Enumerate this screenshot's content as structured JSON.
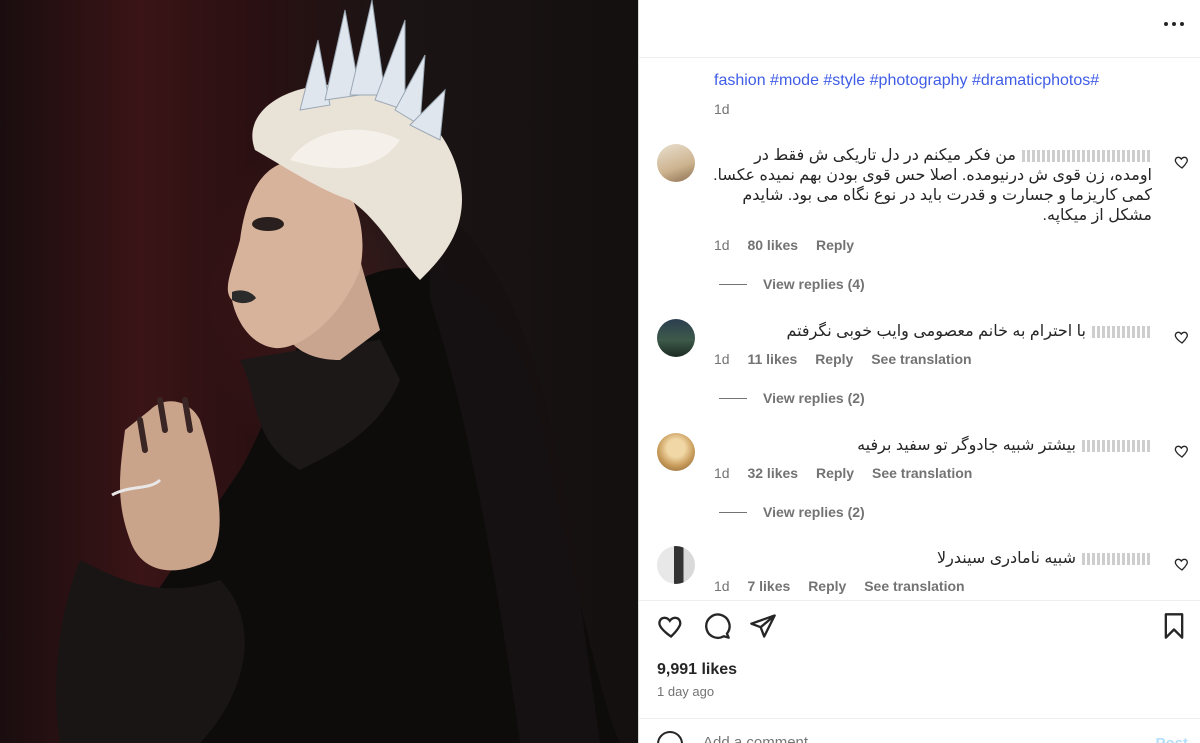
{
  "post": {
    "caption": "fashion #mode #style #photography #dramaticphotos#",
    "caption_time": "1d",
    "likes": "9,991 likes",
    "posted": "1 day ago"
  },
  "comments": [
    {
      "text": "من فکر میکنم در دل تاریکی ش فقط در اومده، زن قوی ش درنیومده. اصلا حس قوی بودن بهم نمیده عکسا. کمی کاریزما و جسارت و قدرت باید در نوع نگاه می بود. شایدم مشکل از میکاپه.",
      "time": "1d",
      "likes": "80 likes",
      "reply": "Reply",
      "translate": "",
      "replies": "View replies (4)"
    },
    {
      "text": "با احترام به خانم معصومی وایب خوبی نگرفتم",
      "time": "1d",
      "likes": "11 likes",
      "reply": "Reply",
      "translate": "See translation",
      "replies": "View replies (2)"
    },
    {
      "text": "بیشتر شبیه جادوگر تو سفید برفیه",
      "time": "1d",
      "likes": "32 likes",
      "reply": "Reply",
      "translate": "See translation",
      "replies": "View replies (2)"
    },
    {
      "text": "شبیه نامادری سیندرلا",
      "time": "1d",
      "likes": "7 likes",
      "reply": "Reply",
      "translate": "See translation",
      "replies": ""
    }
  ],
  "add_comment": {
    "placeholder": "Add a comment...",
    "post_label": "Post"
  },
  "icons": [
    "more-icon",
    "heart-icon",
    "comment-icon",
    "share-icon",
    "bookmark-icon",
    "emoji-icon"
  ],
  "colors": {
    "link": "#405de6",
    "muted": "#737373",
    "text": "#262626",
    "post_button": "#b2dffc"
  }
}
